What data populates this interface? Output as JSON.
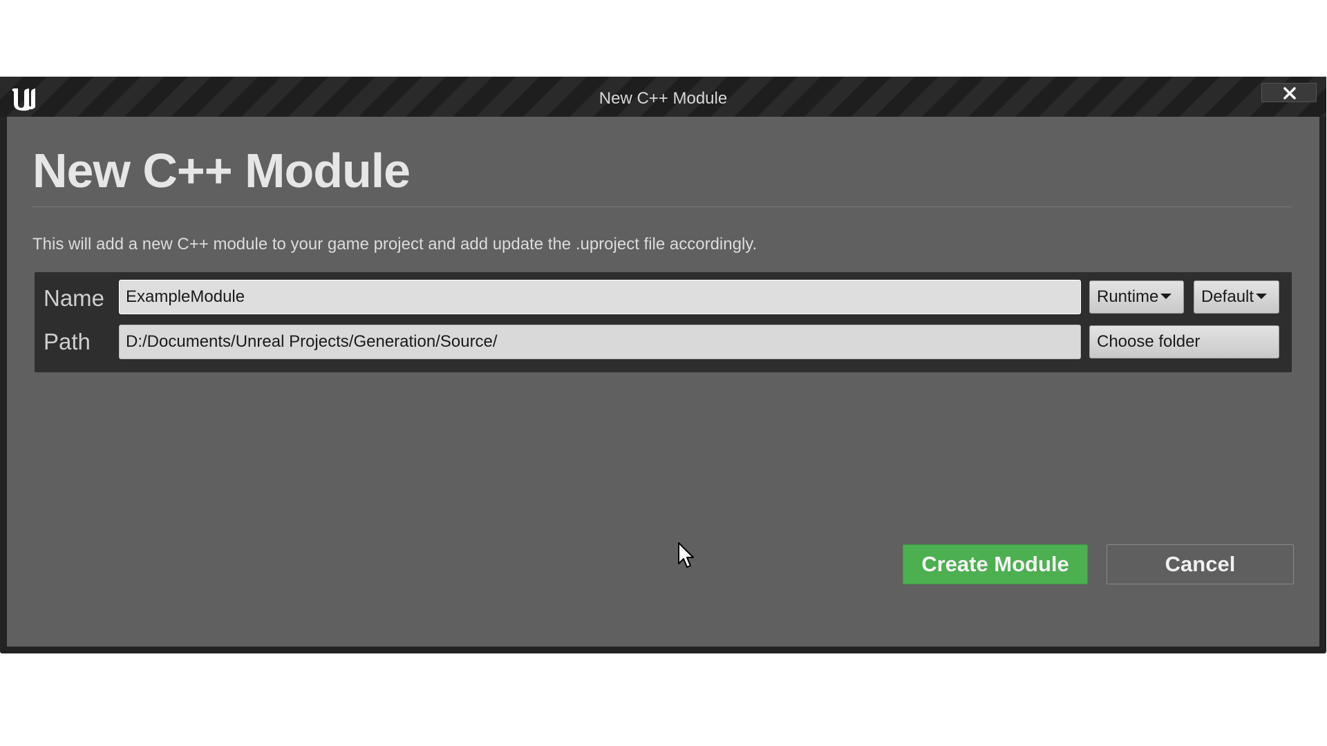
{
  "window": {
    "title": "New C++ Module",
    "logo_icon": "unreal-engine-logo",
    "close_icon": "close-icon"
  },
  "dialog": {
    "heading": "New C++ Module",
    "description": "This will add a new C++ module to your game project and add update the .uproject file accordingly."
  },
  "form": {
    "name_label": "Name",
    "name_value": "ExampleModule",
    "host_type_selected": "Runtime",
    "loading_phase_selected": "Default",
    "path_label": "Path",
    "path_value": "D:/Documents/Unreal Projects/Generation/Source/",
    "choose_folder_label": "Choose folder"
  },
  "actions": {
    "create_label": "Create Module",
    "cancel_label": "Cancel"
  },
  "colors": {
    "primary_action": "#4caf50",
    "panel_background": "#606060",
    "titlebar": "#232323"
  }
}
